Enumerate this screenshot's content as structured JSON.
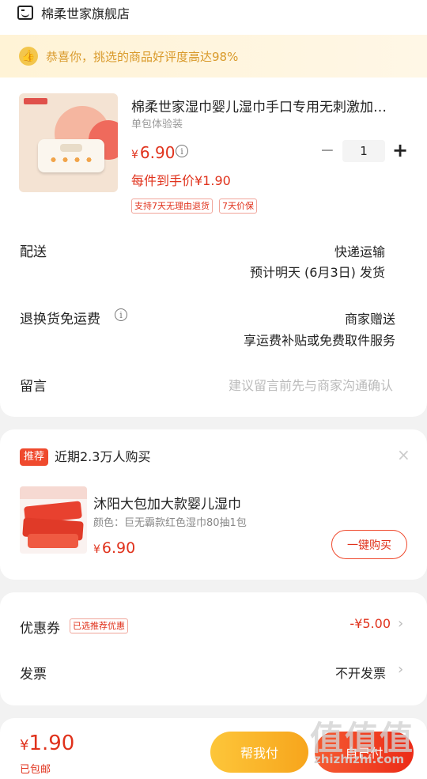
{
  "store": {
    "name": "棉柔世家旗舰店",
    "icon": "store-icon"
  },
  "banner": {
    "text": "恭喜你，挑选的商品好评度高达98%",
    "icon": "thumbs-up-icon"
  },
  "product": {
    "title": "棉柔世家湿巾婴儿湿巾手口专用无刺激加…",
    "spec": "单包体验装",
    "price_symbol": "¥",
    "price": "6.90",
    "unit_price": "每件到手价¥1.90",
    "tags": [
      "支持7天无理由退货",
      "7天价保"
    ],
    "quantity": "1",
    "minus": "−",
    "plus": "+"
  },
  "delivery": {
    "label": "配送",
    "method": "快递运输",
    "eta": "预计明天 (6月3日) 发货"
  },
  "returns": {
    "label": "退换货免运费",
    "value1": "商家赠送",
    "value2": "享运费补贴或免费取件服务"
  },
  "message": {
    "label": "留言",
    "placeholder": "建议留言前先与商家沟通确认"
  },
  "recommend": {
    "badge": "推荐",
    "headline": "近期2.3万人购买",
    "close": "×",
    "item_title": "沐阳大包加大款婴儿湿巾",
    "item_spec": "颜色：巨无霸款红色湿巾80抽1包",
    "price_symbol": "¥",
    "price": "6.90",
    "buy_label": "一键购买"
  },
  "coupon": {
    "label": "优惠券",
    "tag": "已选推荐优惠",
    "value": "-¥5.00",
    "chevron": "›"
  },
  "invoice": {
    "label": "发票",
    "value": "不开发票",
    "chevron": "›"
  },
  "footer": {
    "total_symbol": "¥",
    "total": "1.90",
    "shipping": "已包邮",
    "help_pay": "帮我付",
    "self_pay": "自己付"
  },
  "watermark": {
    "text": "值值值",
    "sub": "zhizhizhi.com"
  },
  "colors": {
    "accent": "#e0321c",
    "help_button": "#fbb62a",
    "banner_text": "#d99a2b"
  }
}
